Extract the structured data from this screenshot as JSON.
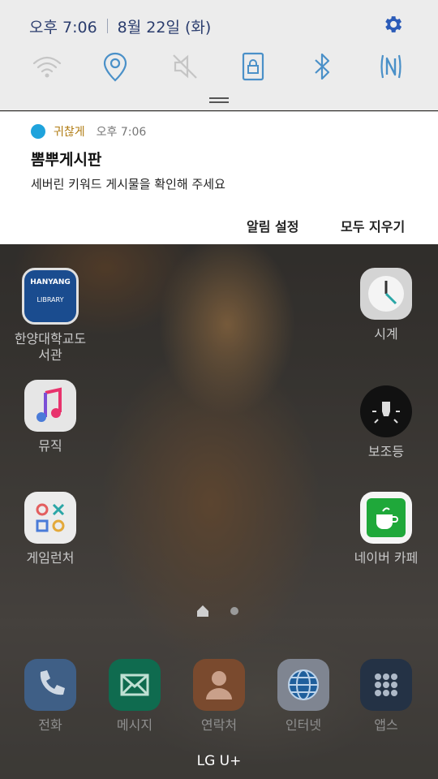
{
  "status": {
    "time": "오후 7:06",
    "date": "8월 22일 (화)"
  },
  "quick_settings": [
    {
      "name": "wifi-icon",
      "active": false
    },
    {
      "name": "location-icon",
      "active": true
    },
    {
      "name": "mute-icon",
      "active": false
    },
    {
      "name": "screen-lock-icon",
      "active": true
    },
    {
      "name": "bluetooth-icon",
      "active": true
    },
    {
      "name": "nfc-icon",
      "active": true
    }
  ],
  "notification": {
    "app": "귀찮게",
    "time": "오후 7:06",
    "title": "뽐뿌게시판",
    "body": "세버린 키워드 게시물을 확인해 주세요",
    "action_settings": "알림 설정",
    "action_clear": "모두 지우기"
  },
  "home": {
    "apps": [
      {
        "label": "한양대학교도서관",
        "line1": "한양대학교도",
        "line2": "서관",
        "icon_text": "HANYANG",
        "icon_sub": "LIBRARY"
      },
      {
        "label": "시계"
      },
      {
        "label": "뮤직"
      },
      {
        "label": "보조등"
      },
      {
        "label": "게임런처"
      },
      {
        "label": "네이버 카페"
      }
    ],
    "dock": [
      {
        "label": "전화"
      },
      {
        "label": "메시지"
      },
      {
        "label": "연락처"
      },
      {
        "label": "인터넷"
      },
      {
        "label": "앱스"
      }
    ]
  },
  "carrier": "LG U+",
  "colors": {
    "accent": "#2b5bb8",
    "panel_bg": "#ececec",
    "quick_active": "#4a90c8",
    "quick_inactive": "#c5c5c5"
  }
}
